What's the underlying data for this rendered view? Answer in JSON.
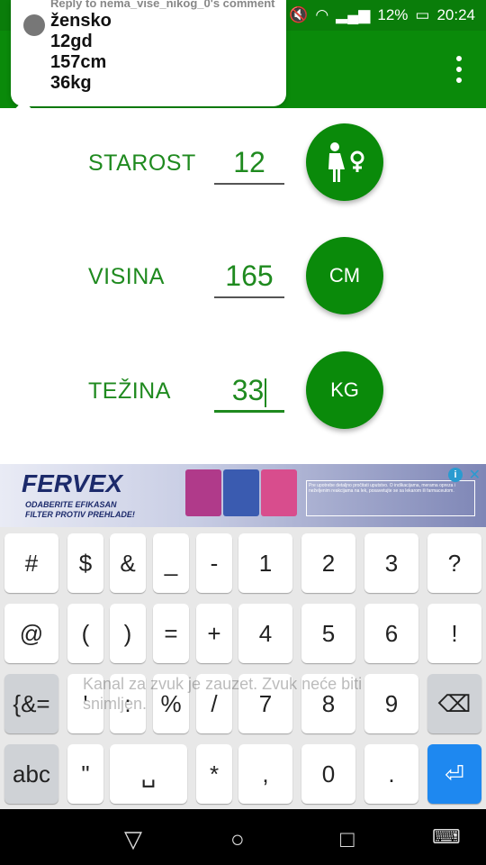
{
  "status": {
    "battery": "12%",
    "time": "20:24"
  },
  "comment": {
    "reply_to": "Reply to nema_vise_nikog_0's comment",
    "lines": [
      "žensko",
      "12gd",
      "157cm",
      "36kg"
    ]
  },
  "form": {
    "age": {
      "label": "STAROST",
      "value": "12",
      "button": "♀"
    },
    "height": {
      "label": "VISINA",
      "value": "165",
      "button": "CM"
    },
    "weight": {
      "label": "TEŽINA",
      "value": "33",
      "button": "KG"
    }
  },
  "ad": {
    "brand": "FERVEX",
    "slogan_1": "ODABERITE EFIKASAN",
    "slogan_2": "FILTER PROTIV PREHLADE!",
    "notice": "Pre upotrebe detaljno pročitati uputstvo. O indikacijama, merama opreza i neželjenim reakcijama na lek, posavetujte se sa lekarom ili farmaceutom.",
    "box_colors": [
      "#b03a8a",
      "#3a5bb0",
      "#d84d8d"
    ]
  },
  "keyboard": {
    "row1": [
      "#",
      "$",
      "&",
      "_",
      "-",
      "1",
      "2",
      "3",
      "?"
    ],
    "row2": [
      "@",
      "(",
      ")",
      "=",
      "+",
      "4",
      "5",
      "6",
      "!"
    ],
    "row3": [
      "{&=",
      "'",
      ":",
      "%",
      "/",
      "7",
      "8",
      "9",
      "⌫"
    ],
    "row4": [
      "abc",
      "\"",
      "␣",
      "*",
      ",",
      "0",
      ".",
      "⏎"
    ]
  },
  "toast": "Kanal za zvuk je zauzet. Zvuk neće biti snimljen.",
  "colors": {
    "brand_green": "#0a8a0a",
    "label_green": "#1f8a1f",
    "enter_blue": "#1e88f0"
  }
}
